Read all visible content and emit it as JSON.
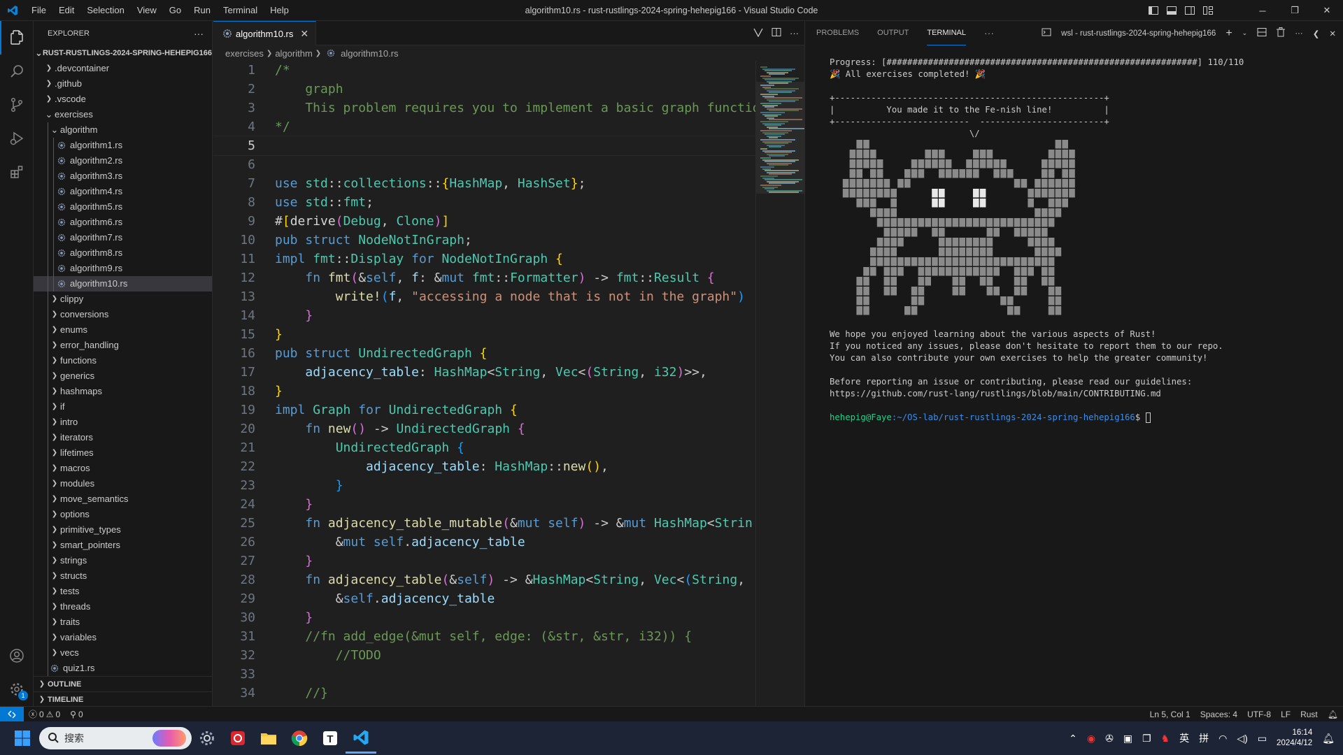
{
  "window": {
    "title": "algorithm10.rs - rust-rustlings-2024-spring-hehepig166 - Visual Studio Code",
    "menu": [
      "File",
      "Edit",
      "Selection",
      "View",
      "Go",
      "Run",
      "Terminal",
      "Help"
    ]
  },
  "sidebar": {
    "header": "EXPLORER",
    "root": "RUST-RUSTLINGS-2024-SPRING-HEHEPIG166",
    "top_folders": [
      ".devcontainer",
      ".github",
      ".vscode"
    ],
    "exercises_label": "exercises",
    "algorithm_label": "algorithm",
    "algorithm_files": [
      "algorithm1.rs",
      "algorithm2.rs",
      "algorithm3.rs",
      "algorithm4.rs",
      "algorithm5.rs",
      "algorithm6.rs",
      "algorithm7.rs",
      "algorithm8.rs",
      "algorithm9.rs",
      "algorithm10.rs"
    ],
    "selected_file": "algorithm10.rs",
    "exercise_folders": [
      "clippy",
      "conversions",
      "enums",
      "error_handling",
      "functions",
      "generics",
      "hashmaps",
      "if",
      "intro",
      "iterators",
      "lifetimes",
      "macros",
      "modules",
      "move_semantics",
      "options",
      "primitive_types",
      "smart_pointers",
      "strings",
      "structs",
      "tests",
      "threads",
      "traits",
      "variables",
      "vecs"
    ],
    "quiz_file": "quiz1.rs",
    "outline": "OUTLINE",
    "timeline": "TIMELINE"
  },
  "editor": {
    "tab_label": "algorithm10.rs",
    "breadcrumb": [
      "exercises",
      "algorithm",
      "algorithm10.rs"
    ],
    "current_line": 5
  },
  "panel": {
    "tabs": [
      "PROBLEMS",
      "OUTPUT",
      "TERMINAL"
    ],
    "active_tab": "TERMINAL",
    "terminal_name": "wsl - rust-rustlings-2024-spring-hehepig166",
    "lines": [
      "Progress: [############################################################] 110/110",
      "🎉 All exercises completed! 🎉",
      "",
      "+----------------------------------------------------+",
      "|          You made it to the Fe-nish line!          |",
      "+--------------------------  ------------------------+",
      "                           \\/",
      "We hope you enjoyed learning about the various aspects of Rust!",
      "If you noticed any issues, please don't hesitate to report them to our repo.",
      "You can also contribute your own exercises to help the greater community!",
      "",
      "Before reporting an issue or contributing, please read our guidelines:",
      "https://github.com/rust-lang/rustlings/blob/main/CONTRIBUTING.md",
      ""
    ],
    "prompt_user": "hehepig@Faye",
    "prompt_path": ":~/OS-lab/rust-rustlings-2024-spring-hehepig166",
    "prompt_symbol": "$ "
  },
  "statusbar": {
    "errors": "0",
    "warnings": "0",
    "ports": "0",
    "position": "Ln 5, Col 1",
    "spaces": "Spaces: 4",
    "encoding": "UTF-8",
    "eol": "LF",
    "language": "Rust"
  },
  "taskbar": {
    "search_placeholder": "搜索",
    "ime1": "英",
    "ime2": "拼",
    "time": "16:14",
    "date": "2024/4/12"
  },
  "colors": {
    "accent": "#0078d4",
    "keyword": "#569cd6",
    "type": "#4ec9b0",
    "function": "#dcdcaa",
    "string": "#ce9178",
    "comment": "#6a9955",
    "terminal_green": "#23d18b",
    "terminal_blue": "#3b8eea"
  },
  "icons": [
    "vscode-logo-icon",
    "files-icon",
    "search-icon",
    "source-control-icon",
    "run-debug-icon",
    "extensions-icon",
    "account-icon",
    "settings-gear-icon",
    "rust-file-icon",
    "windows-start-icon",
    "chrome-icon",
    "folder-icon"
  ],
  "account_badge": "1"
}
